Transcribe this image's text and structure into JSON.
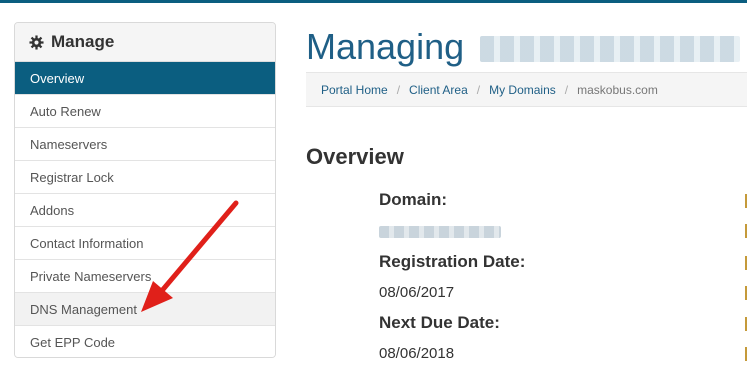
{
  "sidebar": {
    "header": "Manage",
    "items": [
      {
        "label": "Overview"
      },
      {
        "label": "Auto Renew"
      },
      {
        "label": "Nameservers"
      },
      {
        "label": "Registrar Lock"
      },
      {
        "label": "Addons"
      },
      {
        "label": "Contact Information"
      },
      {
        "label": "Private Nameservers"
      },
      {
        "label": "DNS Management"
      },
      {
        "label": "Get EPP Code"
      }
    ]
  },
  "page": {
    "title": "Managing"
  },
  "breadcrumb": {
    "portal_home": "Portal Home",
    "client_area": "Client Area",
    "my_domains": "My Domains",
    "current": "maskobus.com"
  },
  "overview": {
    "title": "Overview",
    "domain_label": "Domain:",
    "registration_date_label": "Registration Date:",
    "registration_date": "08/06/2017",
    "next_due_date_label": "Next Due Date:",
    "next_due_date": "08/06/2018"
  },
  "colors": {
    "accent": "#0b5e80",
    "title": "#1f5f86",
    "annotation_arrow": "#e0201a"
  },
  "icons": {
    "sidebar_header": "gear-icon",
    "annotation": "red-arrow-annotation"
  }
}
